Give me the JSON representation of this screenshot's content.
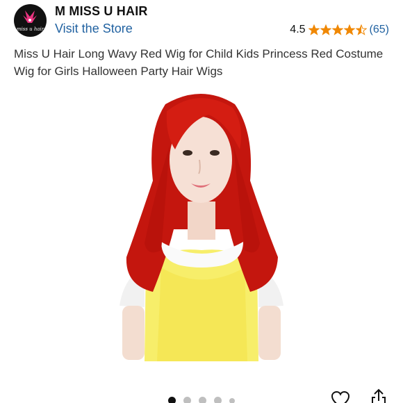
{
  "store": {
    "logo_text": "miss u hair",
    "name": "M MISS U HAIR",
    "visit_label": "Visit the Store"
  },
  "rating": {
    "value": "4.5",
    "stars": 4.5,
    "count": "(65)",
    "star_color": "#f08804"
  },
  "product": {
    "title": "Miss U Hair Long Wavy Red Wig for Child Kids Princess Red Costume Wig for Girls Halloween Party Hair Wigs",
    "image_icon": "product-photo"
  },
  "gallery": {
    "total_dots": 5,
    "active_index": 0
  },
  "actions": {
    "wishlist_icon": "heart-icon",
    "share_icon": "share-icon"
  },
  "colors": {
    "link": "#2162a1",
    "accent": "#f08804"
  }
}
